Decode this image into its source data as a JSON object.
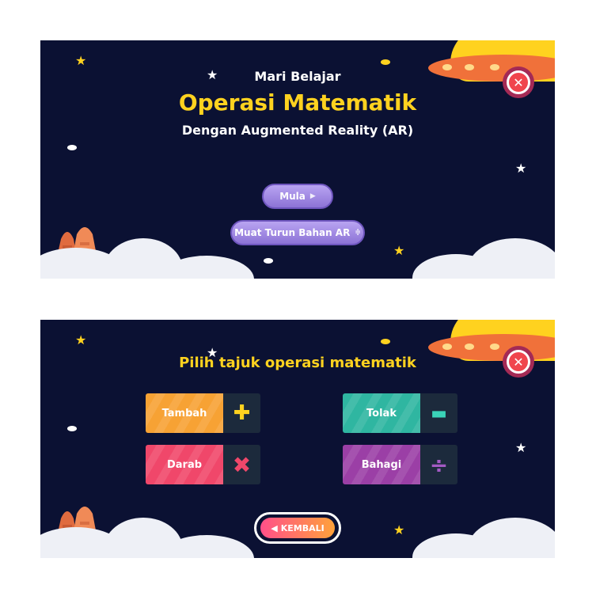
{
  "home": {
    "subtitle": "Mari Belajar",
    "title": "Operasi Matematik",
    "tagline": "Dengan Augmented Reality (AR)",
    "start_label": "Mula",
    "download_label": "Muat Turun Bahan AR",
    "close_symbol": "✕"
  },
  "topics": {
    "heading": "Pilih tajuk operasi matematik",
    "items": [
      {
        "label": "Tambah",
        "symbol": "✚",
        "color": "#f7a234",
        "symbol_color": "#ffd21f"
      },
      {
        "label": "Tolak",
        "symbol": "▬",
        "color": "#2fb6a1",
        "symbol_color": "#3ad3b8"
      },
      {
        "label": "Darab",
        "symbol": "✖",
        "color": "#f0476a",
        "symbol_color": "#f0476a"
      },
      {
        "label": "Bahagi",
        "symbol": "÷",
        "color": "#9b3fa6",
        "symbol_color": "#a45ac4"
      }
    ],
    "back_label": "KEMBALI",
    "close_symbol": "✕"
  },
  "colors": {
    "background": "#0b1133",
    "title_yellow": "#ffd21f",
    "button_purple": "#9a84e4",
    "close_red": "#f0454d"
  }
}
